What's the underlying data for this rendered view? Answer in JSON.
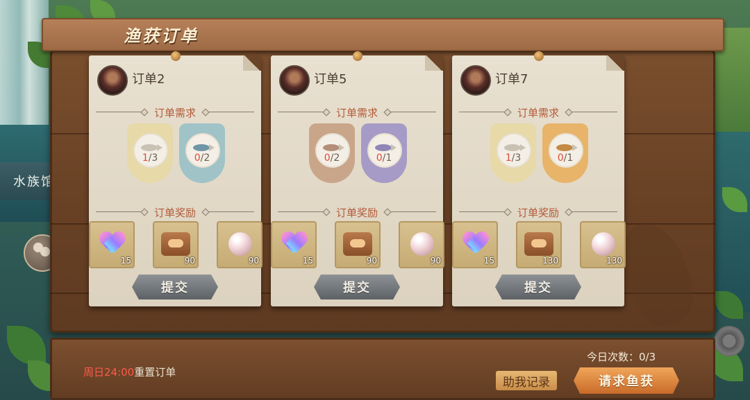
{
  "panel": {
    "title": "渔获订单"
  },
  "side": {
    "aquarium_label": "水族馆"
  },
  "orders": [
    {
      "name": "订单2",
      "requirement_title": "订单需求",
      "requirements": [
        {
          "icon": "small-fish-icon",
          "done": "1",
          "total": "/3",
          "color": "#e7d9a8"
        },
        {
          "icon": "tuna-icon",
          "done": "0",
          "total": "/2",
          "color": "#9fc3c7"
        }
      ],
      "reward_title": "订单奖励",
      "rewards": [
        {
          "icon": "heart-icon",
          "qty": "15"
        },
        {
          "icon": "handshake-icon",
          "qty": "90"
        },
        {
          "icon": "pearl-icon",
          "qty": "90"
        }
      ],
      "submit_label": "提交"
    },
    {
      "name": "订单5",
      "requirement_title": "订单需求",
      "requirements": [
        {
          "icon": "small-fish-icon",
          "done": "0",
          "total": "/2",
          "color": "#c9a58a"
        },
        {
          "icon": "shark-icon",
          "done": "0",
          "total": "/1",
          "color": "#a69bc6"
        }
      ],
      "reward_title": "订单奖励",
      "rewards": [
        {
          "icon": "heart-icon",
          "qty": "15"
        },
        {
          "icon": "handshake-icon",
          "qty": "90"
        },
        {
          "icon": "pearl-icon",
          "qty": "90"
        }
      ],
      "submit_label": "提交"
    },
    {
      "name": "订单7",
      "requirement_title": "订单需求",
      "requirements": [
        {
          "icon": "small-fish-icon",
          "done": "1",
          "total": "/3",
          "color": "#e7d9a8"
        },
        {
          "icon": "whale-icon",
          "done": "0",
          "total": "/1",
          "color": "#e8b46a"
        }
      ],
      "reward_title": "订单奖励",
      "rewards": [
        {
          "icon": "heart-icon",
          "qty": "15"
        },
        {
          "icon": "handshake-icon",
          "qty": "130"
        },
        {
          "icon": "pearl-icon",
          "qty": "130"
        }
      ],
      "submit_label": "提交"
    }
  ],
  "footer": {
    "reset_time": "周日24:00",
    "reset_suffix": "重置订单",
    "today_label": "今日次数：0/3",
    "help_label": "助我记录",
    "request_label": "请求鱼获"
  }
}
